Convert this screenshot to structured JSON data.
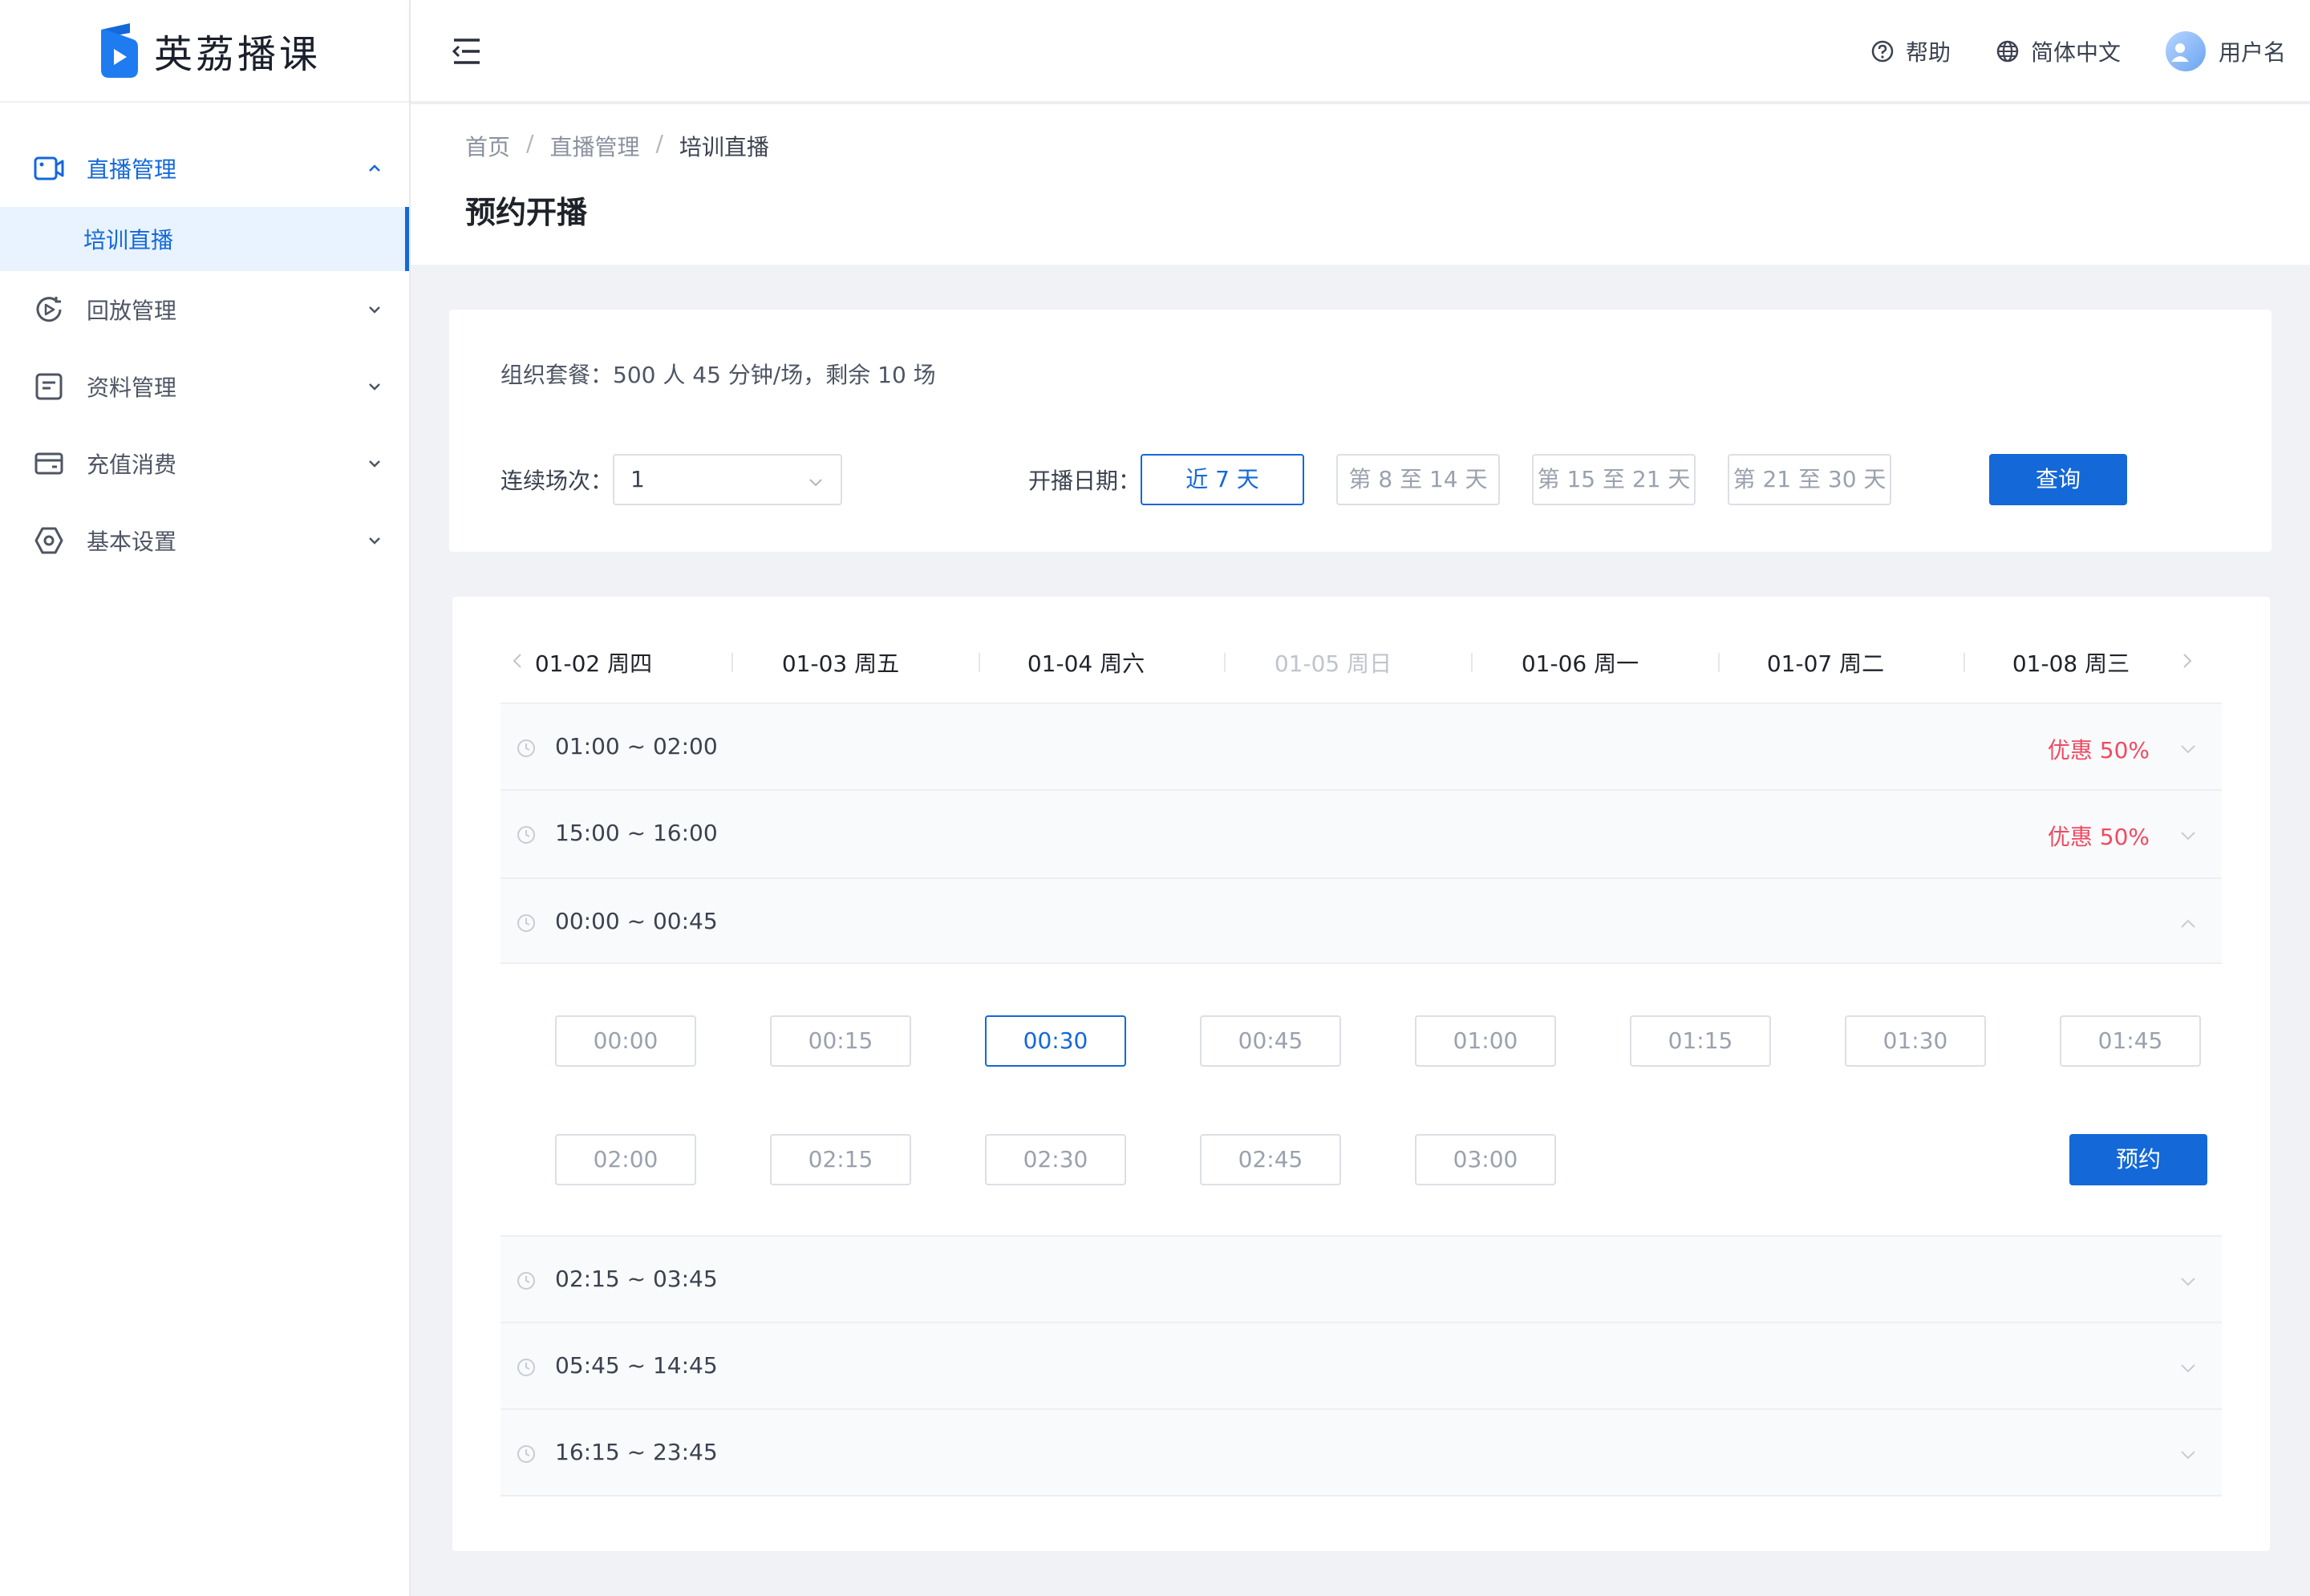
{
  "app": {
    "name": "英荔播课"
  },
  "sidebar": {
    "items": [
      {
        "label": "直播管理",
        "icon": "video-camera-icon",
        "active": true
      },
      {
        "label": "回放管理",
        "icon": "playback-icon"
      },
      {
        "label": "资料管理",
        "icon": "document-icon"
      },
      {
        "label": "充值消费",
        "icon": "wallet-icon"
      },
      {
        "label": "基本设置",
        "icon": "settings-icon"
      }
    ],
    "sub_item": {
      "label": "培训直播"
    }
  },
  "header": {
    "help": "帮助",
    "language": "简体中文",
    "username": "用户名"
  },
  "breadcrumb": [
    "首页",
    "直播管理",
    "培训直播"
  ],
  "page_title": "预约开播",
  "filters": {
    "package_label": "组织套餐：",
    "package_value": "500 人 45 分钟/场，剩余 10 场",
    "sessions_label": "连续场次：",
    "sessions_value": "1",
    "date_label": "开播日期：",
    "ranges": [
      "近 7 天",
      "第 8 至 14 天",
      "第 15 至 21 天",
      "第 21 至 30 天"
    ],
    "selected_range": 0,
    "query_label": "查询"
  },
  "days": [
    {
      "label": "01-02 周四"
    },
    {
      "label": "01-03 周五"
    },
    {
      "label": "01-04 周六"
    },
    {
      "label": "01-05 周日",
      "disabled": true
    },
    {
      "label": "01-06 周一"
    },
    {
      "label": "01-07 周二"
    },
    {
      "label": "01-08 周三"
    }
  ],
  "time_ranges": [
    {
      "range": "01:00 ~ 02:00",
      "discount": "优惠 50%"
    },
    {
      "range": "15:00 ~ 16:00",
      "discount": "优惠 50%"
    },
    {
      "range": "00:00 ~ 00:45",
      "expanded": true
    },
    {
      "range": "02:15 ~ 03:45"
    },
    {
      "range": "05:45 ~ 14:45"
    },
    {
      "range": "16:15 ~ 23:45"
    }
  ],
  "slots": [
    "00:00",
    "00:15",
    "00:30",
    "00:45",
    "01:00",
    "01:15",
    "01:30",
    "01:45",
    "02:00",
    "02:15",
    "02:30",
    "02:45",
    "03:00"
  ],
  "selected_slot": "00:30",
  "book_label": "预约",
  "colors": {
    "primary": "#1468d8",
    "discount": "#f04a63",
    "active_bg": "#e8f3ff"
  }
}
